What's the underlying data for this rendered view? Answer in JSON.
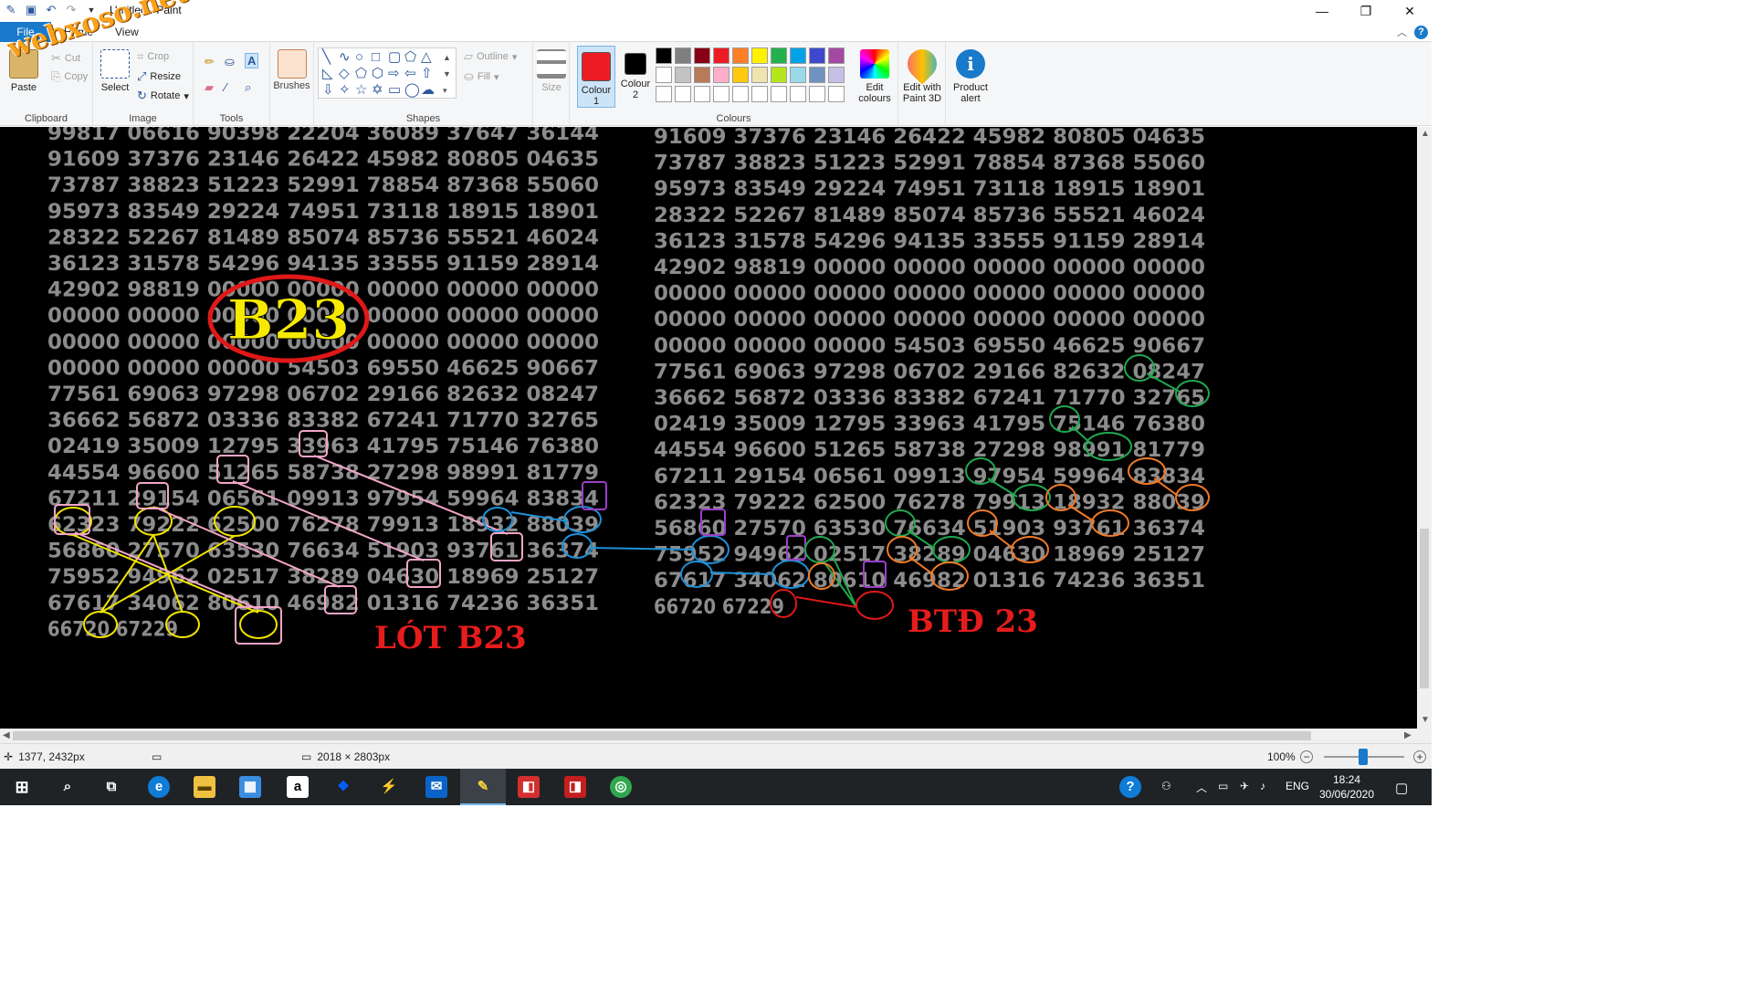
{
  "window": {
    "title": "Untitled - Paint",
    "controls": [
      "minimize",
      "restore",
      "close"
    ]
  },
  "watermark": "webxoso.net",
  "tabs": {
    "file": "File",
    "home": "Home",
    "view": "View"
  },
  "ribbon": {
    "clipboard": {
      "label": "Clipboard",
      "paste": "Paste",
      "cut": "Cut",
      "copy": "Copy"
    },
    "image": {
      "label": "Image",
      "select": "Select",
      "crop": "Crop",
      "resize": "Resize",
      "rotate": "Rotate"
    },
    "tools": {
      "label": "Tools"
    },
    "brushes": {
      "label": "Brushes"
    },
    "shapes": {
      "label": "Shapes",
      "outline": "Outline",
      "fill": "Fill"
    },
    "size": {
      "label": "Size"
    },
    "colours": {
      "label": "Colours",
      "colour1": "Colour 1",
      "colour2": "Colour 2",
      "colour1_value": "#ed1c24",
      "colour2_value": "#000000",
      "edit_colours": "Edit colours",
      "edit_with_paint3d": "Edit with Paint 3D",
      "product_alert": "Product alert",
      "palette_row1": [
        "#000000",
        "#7f7f7f",
        "#880015",
        "#ed1c24",
        "#ff7f27",
        "#fff200",
        "#22b14c",
        "#00a2e8",
        "#3f48cc",
        "#a349a4"
      ],
      "palette_row2": [
        "#ffffff",
        "#c3c3c3",
        "#b97a57",
        "#ffaec9",
        "#ffc90e",
        "#efe4b0",
        "#b5e61d",
        "#99d9ea",
        "#7092be",
        "#c8bfe7"
      ]
    }
  },
  "canvas": {
    "left_grid": [
      "99817 06616 90398 22204 36089 37647 36144",
      "91609 37376 23146 26422 45982 80805 04635",
      "73787 38823 51223 52991 78854 87368 55060",
      "95973 83549 29224 74951 73118 18915 18901",
      "28322 52267 81489 85074 85736 55521 46024",
      "36123 31578 54296 94135 33555 91159 28914",
      "42902 98819 00000 00000 00000 00000 00000",
      "00000 00000 00000 00000 00000 00000 00000",
      "00000 00000 00000 00000 00000 00000 00000",
      "00000 00000 00000 54503 69550 46625 90667",
      "77561 69063 97298 06702 29166 82632 08247",
      "36662 56872 03336 83382 67241 71770 32765",
      "02419 35009 12795 33963 41795 75146 76380",
      "44554 96600 51265 58738 27298 98991 81779",
      "67211 29154 06561 09913 97954 59964 83834",
      "62323 79222 62500 76278 79913 18932 88039",
      "56860 27570 63530 76634 51903 93761 36374",
      "75952 94962 02517 38289 04630 18969 25127",
      "67617 34062 80610 46982 01316 74236 36351",
      "66720 67229"
    ],
    "right_grid": [
      "91609 37376 23146 26422 45982 80805 04635",
      "73787 38823 51223 52991 78854 87368 55060",
      "95973 83549 29224 74951 73118 18915 18901",
      "28322 52267 81489 85074 85736 55521 46024",
      "36123 31578 54296 94135 33555 91159 28914",
      "42902 98819 00000 00000 00000 00000 00000",
      "00000 00000 00000 00000 00000 00000 00000",
      "00000 00000 00000 00000 00000 00000 00000",
      "00000 00000 00000 54503 69550 46625 90667",
      "77561 69063 97298 06702 29166 82632 08247",
      "36662 56872 03336 83382 67241 71770 32765",
      "02419 35009 12795 33963 41795 75146 76380",
      "44554 96600 51265 58738 27298 98991 81779",
      "67211 29154 06561 09913 97954 59964 83834",
      "62323 79222 62500 76278 79913 18932 88039",
      "56860 27570 63530 76634 51903 93761 36374",
      "75952 94962 02517 38289 04630 18969 25127",
      "67617 34062 80610 46982 01316 74236 36351",
      "66720 67229"
    ],
    "badge_b23": "B23",
    "label_lot": "LÓT B23",
    "label_btd": "BTĐ 23"
  },
  "statusbar": {
    "cursor_pos": "1377, 2432px",
    "image_size": "2018 × 2803px",
    "zoom": "100%"
  },
  "taskbar": {
    "language": "ENG",
    "time": "18:24",
    "date": "30/06/2020"
  }
}
